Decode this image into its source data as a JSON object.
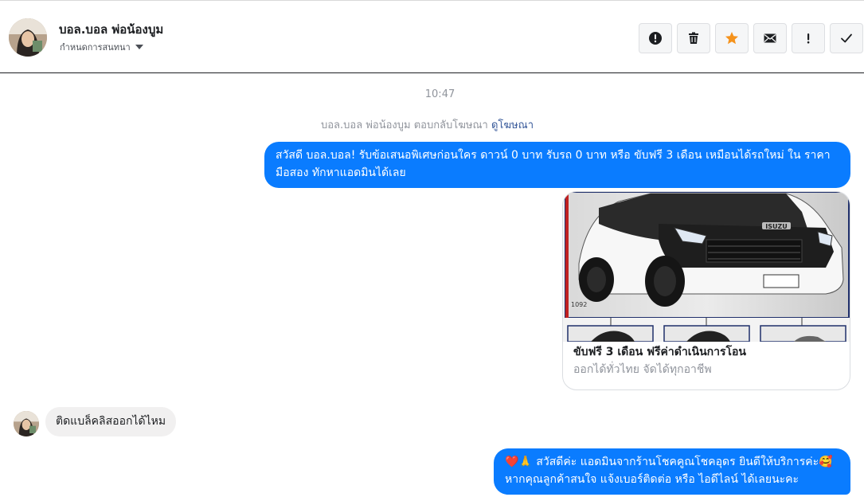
{
  "header": {
    "contact_name": "บอล.บอล พ่อน้องบูม",
    "assign_label": "กำหนดการสนทนา",
    "actions": [
      {
        "name": "mark-spam-button",
        "icon": "exclamation-circle-icon"
      },
      {
        "name": "delete-button",
        "icon": "trash-icon"
      },
      {
        "name": "star-button",
        "icon": "star-icon",
        "color": "#f5921b"
      },
      {
        "name": "mark-unread-button",
        "icon": "envelope-icon"
      },
      {
        "name": "follow-up-button",
        "icon": "exclamation-icon"
      },
      {
        "name": "mark-done-button",
        "icon": "checkmark-icon"
      }
    ]
  },
  "chat": {
    "timestamp": "10:47",
    "ad_reply_text": "บอล.บอล พ่อน้องบูม ตอบกลับโฆษณา",
    "ad_reply_link": "ดูโฆษณา",
    "messages": [
      {
        "text": "สวัสดี บอล.บอล! รับข้อเสนอพิเศษก่อนใคร ดาวน์ 0 บาท รับรถ 0 บาท หรือ ขับฟรี 3 เดือน เหมือนได้รถใหม่ ใน ราคามือสอง ทักหาแอดมินได้เลย"
      },
      {
        "card_title": "ขับฟรี 3 เดือน ฟรีค่าดำเนินการโอน",
        "card_subtitle": "ออกได้ทั่วไทย จัดได้ทุกอาชีพ",
        "image_brand": "ISUZU",
        "image_plate": "1092"
      },
      {
        "text": "ติดแบล็คลิสออกได้ไหม"
      },
      {
        "text": "❤️🙏 สวัสดีค่ะ แอดมินจากร้านโชคคูณโชคอุดร ยินดีให้บริการค่ะ🥰 หากคุณลูกค้าสนใจ แจ้งเบอร์ติดต่อ หรือ ไอดีไลน์ ได้เลยนะคะ"
      }
    ]
  },
  "colors": {
    "accent": "#0a7cff",
    "incoming_bubble": "#f1f0f0",
    "star": "#f5921b"
  }
}
